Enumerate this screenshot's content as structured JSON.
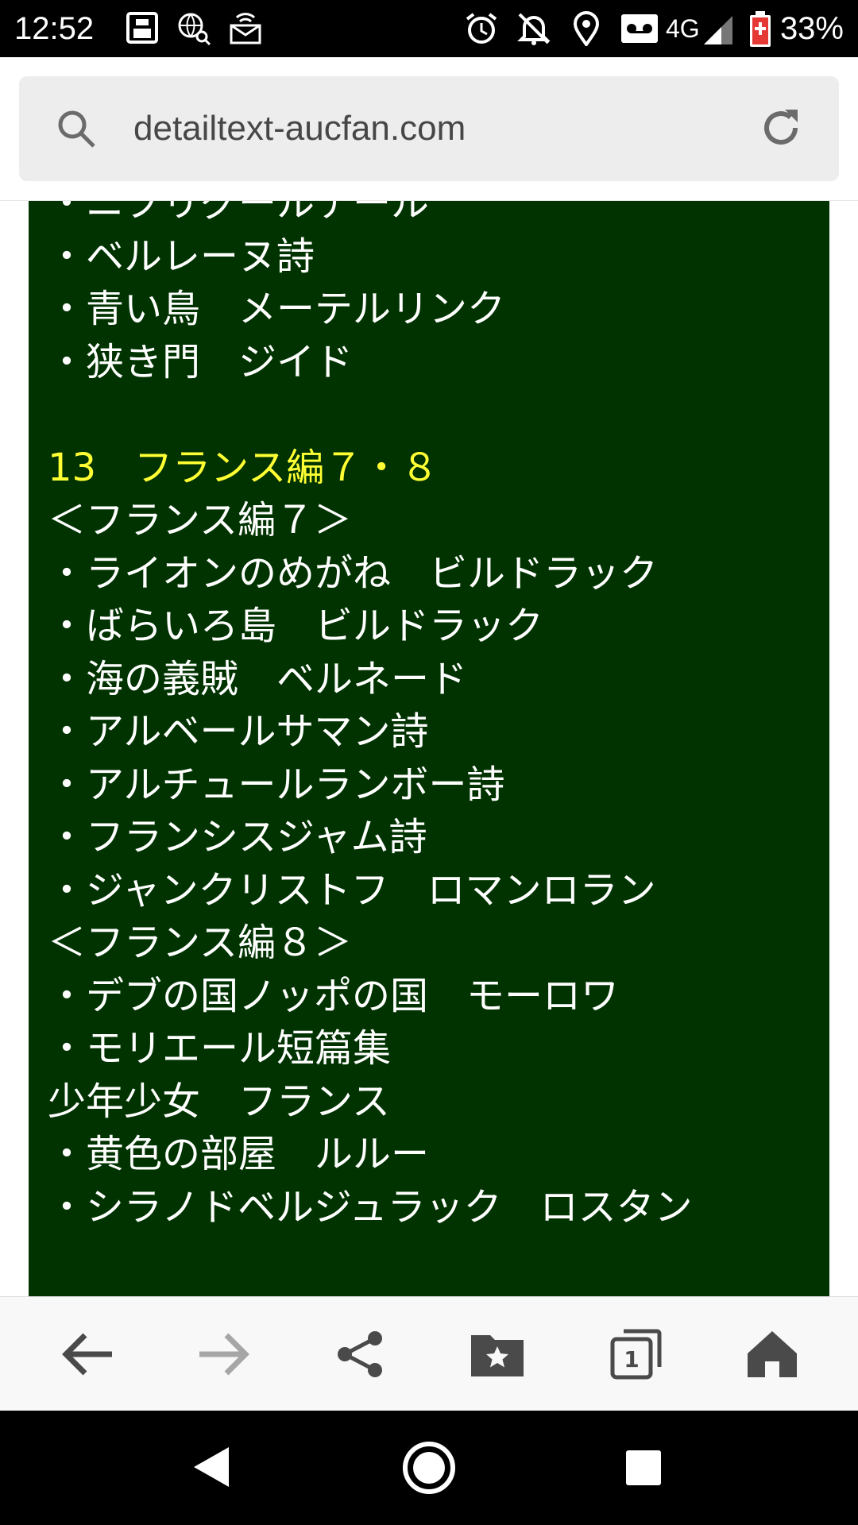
{
  "status_bar": {
    "time": "12:52",
    "network": "4G",
    "battery_percent": "33%",
    "icons": [
      "clipboard-icon",
      "globe-search-icon",
      "cast-mail-icon",
      "alarm-icon",
      "notifications-off-icon",
      "location-icon",
      "voicemail-icon",
      "signal-icon",
      "battery-icon"
    ]
  },
  "browser": {
    "url": "detailtext-aucfan.com",
    "icons": {
      "search": "search-icon",
      "reload": "reload-icon"
    }
  },
  "content": {
    "background_color": "#003300",
    "text_color": "#ffffff",
    "heading_color": "#ffff33",
    "lines": [
      {
        "text": "・ニブリグールテール",
        "type": "item"
      },
      {
        "text": "・ベルレーヌ詩",
        "type": "item"
      },
      {
        "text": "・青い鳥　メーテルリンク",
        "type": "item"
      },
      {
        "text": "・狭き門　ジイド",
        "type": "item"
      },
      {
        "text": "",
        "type": "blank"
      },
      {
        "text": "13　フランス編７・８",
        "type": "heading"
      },
      {
        "text": "＜フランス編７＞",
        "type": "item"
      },
      {
        "text": "・ライオンのめがね　ビルドラック",
        "type": "item"
      },
      {
        "text": "・ばらいろ島　ビルドラック",
        "type": "item"
      },
      {
        "text": "・海の義賊　ベルネード",
        "type": "item"
      },
      {
        "text": "・アルベールサマン詩",
        "type": "item"
      },
      {
        "text": "・アルチュールランボー詩",
        "type": "item"
      },
      {
        "text": "・フランシスジャム詩",
        "type": "item"
      },
      {
        "text": "・ジャンクリストフ　ロマンロラン",
        "type": "item"
      },
      {
        "text": "＜フランス編８＞",
        "type": "item"
      },
      {
        "text": "・デブの国ノッポの国　モーロワ",
        "type": "item"
      },
      {
        "text": "・モリエール短篇集",
        "type": "item"
      },
      {
        "text": "少年少女　フランス",
        "type": "item"
      },
      {
        "text": "・黄色の部屋　ルルー",
        "type": "item"
      },
      {
        "text": "・シラノドベルジュラック　ロスタン",
        "type": "item"
      }
    ]
  },
  "bottom_bar": {
    "tab_count": "1",
    "buttons": [
      "back-icon",
      "forward-icon",
      "share-icon",
      "bookmarks-icon",
      "tabs-icon",
      "home-icon"
    ]
  },
  "nav_bar": {
    "buttons": [
      "nav-back-icon",
      "nav-home-icon",
      "nav-recents-icon"
    ]
  }
}
